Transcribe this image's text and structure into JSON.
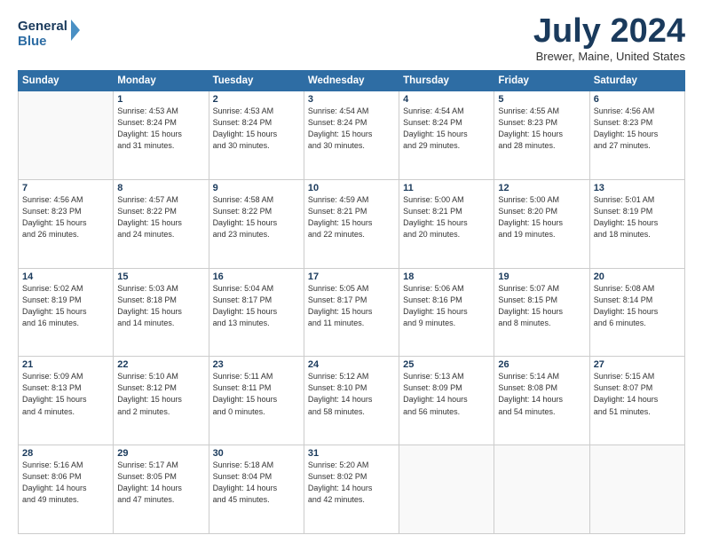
{
  "header": {
    "logo_line1": "General",
    "logo_line2": "Blue",
    "month_title": "July 2024",
    "location": "Brewer, Maine, United States"
  },
  "weekdays": [
    "Sunday",
    "Monday",
    "Tuesday",
    "Wednesday",
    "Thursday",
    "Friday",
    "Saturday"
  ],
  "weeks": [
    [
      {
        "day": "",
        "info": ""
      },
      {
        "day": "1",
        "info": "Sunrise: 4:53 AM\nSunset: 8:24 PM\nDaylight: 15 hours\nand 31 minutes."
      },
      {
        "day": "2",
        "info": "Sunrise: 4:53 AM\nSunset: 8:24 PM\nDaylight: 15 hours\nand 30 minutes."
      },
      {
        "day": "3",
        "info": "Sunrise: 4:54 AM\nSunset: 8:24 PM\nDaylight: 15 hours\nand 30 minutes."
      },
      {
        "day": "4",
        "info": "Sunrise: 4:54 AM\nSunset: 8:24 PM\nDaylight: 15 hours\nand 29 minutes."
      },
      {
        "day": "5",
        "info": "Sunrise: 4:55 AM\nSunset: 8:23 PM\nDaylight: 15 hours\nand 28 minutes."
      },
      {
        "day": "6",
        "info": "Sunrise: 4:56 AM\nSunset: 8:23 PM\nDaylight: 15 hours\nand 27 minutes."
      }
    ],
    [
      {
        "day": "7",
        "info": "Sunrise: 4:56 AM\nSunset: 8:23 PM\nDaylight: 15 hours\nand 26 minutes."
      },
      {
        "day": "8",
        "info": "Sunrise: 4:57 AM\nSunset: 8:22 PM\nDaylight: 15 hours\nand 24 minutes."
      },
      {
        "day": "9",
        "info": "Sunrise: 4:58 AM\nSunset: 8:22 PM\nDaylight: 15 hours\nand 23 minutes."
      },
      {
        "day": "10",
        "info": "Sunrise: 4:59 AM\nSunset: 8:21 PM\nDaylight: 15 hours\nand 22 minutes."
      },
      {
        "day": "11",
        "info": "Sunrise: 5:00 AM\nSunset: 8:21 PM\nDaylight: 15 hours\nand 20 minutes."
      },
      {
        "day": "12",
        "info": "Sunrise: 5:00 AM\nSunset: 8:20 PM\nDaylight: 15 hours\nand 19 minutes."
      },
      {
        "day": "13",
        "info": "Sunrise: 5:01 AM\nSunset: 8:19 PM\nDaylight: 15 hours\nand 18 minutes."
      }
    ],
    [
      {
        "day": "14",
        "info": "Sunrise: 5:02 AM\nSunset: 8:19 PM\nDaylight: 15 hours\nand 16 minutes."
      },
      {
        "day": "15",
        "info": "Sunrise: 5:03 AM\nSunset: 8:18 PM\nDaylight: 15 hours\nand 14 minutes."
      },
      {
        "day": "16",
        "info": "Sunrise: 5:04 AM\nSunset: 8:17 PM\nDaylight: 15 hours\nand 13 minutes."
      },
      {
        "day": "17",
        "info": "Sunrise: 5:05 AM\nSunset: 8:17 PM\nDaylight: 15 hours\nand 11 minutes."
      },
      {
        "day": "18",
        "info": "Sunrise: 5:06 AM\nSunset: 8:16 PM\nDaylight: 15 hours\nand 9 minutes."
      },
      {
        "day": "19",
        "info": "Sunrise: 5:07 AM\nSunset: 8:15 PM\nDaylight: 15 hours\nand 8 minutes."
      },
      {
        "day": "20",
        "info": "Sunrise: 5:08 AM\nSunset: 8:14 PM\nDaylight: 15 hours\nand 6 minutes."
      }
    ],
    [
      {
        "day": "21",
        "info": "Sunrise: 5:09 AM\nSunset: 8:13 PM\nDaylight: 15 hours\nand 4 minutes."
      },
      {
        "day": "22",
        "info": "Sunrise: 5:10 AM\nSunset: 8:12 PM\nDaylight: 15 hours\nand 2 minutes."
      },
      {
        "day": "23",
        "info": "Sunrise: 5:11 AM\nSunset: 8:11 PM\nDaylight: 15 hours\nand 0 minutes."
      },
      {
        "day": "24",
        "info": "Sunrise: 5:12 AM\nSunset: 8:10 PM\nDaylight: 14 hours\nand 58 minutes."
      },
      {
        "day": "25",
        "info": "Sunrise: 5:13 AM\nSunset: 8:09 PM\nDaylight: 14 hours\nand 56 minutes."
      },
      {
        "day": "26",
        "info": "Sunrise: 5:14 AM\nSunset: 8:08 PM\nDaylight: 14 hours\nand 54 minutes."
      },
      {
        "day": "27",
        "info": "Sunrise: 5:15 AM\nSunset: 8:07 PM\nDaylight: 14 hours\nand 51 minutes."
      }
    ],
    [
      {
        "day": "28",
        "info": "Sunrise: 5:16 AM\nSunset: 8:06 PM\nDaylight: 14 hours\nand 49 minutes."
      },
      {
        "day": "29",
        "info": "Sunrise: 5:17 AM\nSunset: 8:05 PM\nDaylight: 14 hours\nand 47 minutes."
      },
      {
        "day": "30",
        "info": "Sunrise: 5:18 AM\nSunset: 8:04 PM\nDaylight: 14 hours\nand 45 minutes."
      },
      {
        "day": "31",
        "info": "Sunrise: 5:20 AM\nSunset: 8:02 PM\nDaylight: 14 hours\nand 42 minutes."
      },
      {
        "day": "",
        "info": ""
      },
      {
        "day": "",
        "info": ""
      },
      {
        "day": "",
        "info": ""
      }
    ]
  ]
}
